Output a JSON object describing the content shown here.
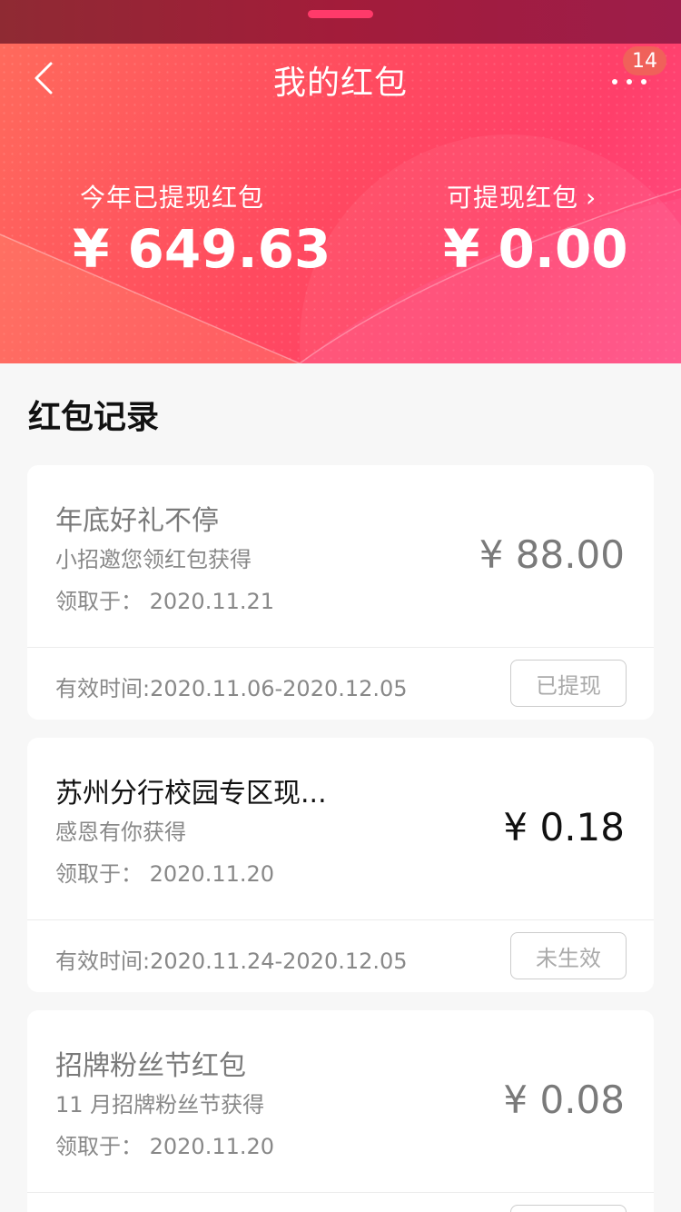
{
  "nav": {
    "title": "我的红包",
    "badge": "14"
  },
  "summary": {
    "withdrawn_label": "今年已提现红包",
    "withdrawn_value": "¥ 649.63",
    "available_label": "可提现红包",
    "available_value": "¥ 0.00"
  },
  "section": {
    "title": "红包记录"
  },
  "records": [
    {
      "title": "年底好礼不停",
      "source": "小招邀您领红包获得",
      "date": "领取于： 2020.11.21",
      "amount": "¥ 88.00",
      "validity": "有效时间:2020.11.06-2020.12.05",
      "status": "已提现"
    },
    {
      "title": "苏州分行校园专区现...",
      "source": "感恩有你获得",
      "date": "领取于： 2020.11.20",
      "amount": "¥ 0.18",
      "validity": "有效时间:2020.11.24-2020.12.05",
      "status": "未生效"
    },
    {
      "title": "招牌粉丝节红包",
      "source": "11 月招牌粉丝节获得",
      "date": "领取于： 2020.11.20",
      "amount": "¥ 0.08",
      "validity": "",
      "status": ""
    }
  ],
  "colors": {
    "accent": "#ff4a5f",
    "badge": "#f0615a"
  }
}
